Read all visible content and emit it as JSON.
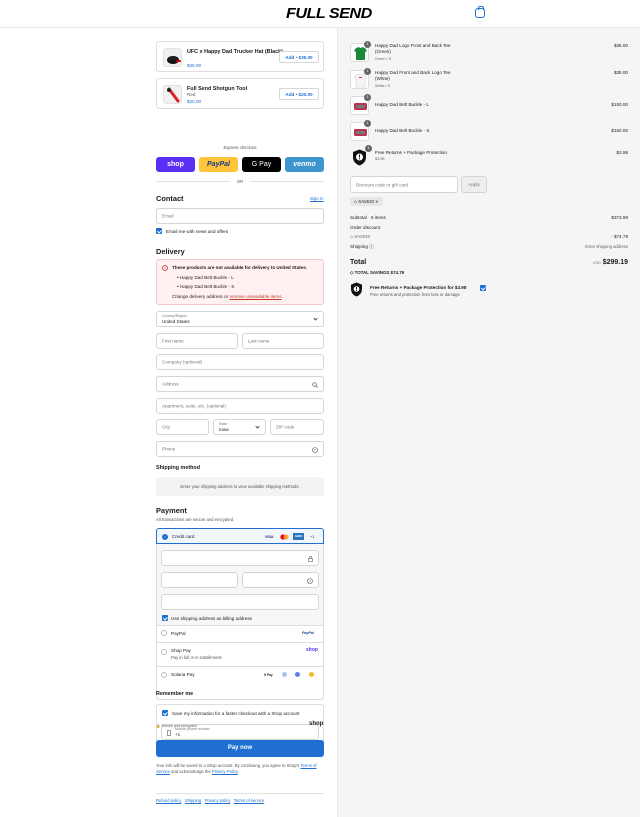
{
  "brand": {
    "logo": "FULL SEND"
  },
  "upsells": [
    {
      "name": "UFC x Happy Dad Trucker Hat (Black)",
      "variant": "",
      "price": "$35.00",
      "add_label": "Add • $35.00"
    },
    {
      "name": "Full Send Shotgun Tool",
      "variant": "Red",
      "price": "$20.00",
      "add_label": "Add • $20.00"
    }
  ],
  "express": {
    "label": "Express checkout",
    "or": "OR",
    "shop": "shop",
    "paypal": "PayPal",
    "gpay": "G Pay",
    "venmo": "venmo"
  },
  "contact": {
    "title": "Contact",
    "sign_in": "Sign in",
    "email_placeholder": "Email",
    "news_label": "Email me with news and offers"
  },
  "delivery": {
    "title": "Delivery",
    "alert_title": "These products are not available for delivery to United States.",
    "alert_items": [
      "Happy Dad Belt Buckle - L",
      "Happy Dad Belt Buckle - S"
    ],
    "alert_footer_prefix": "Change delivery address or",
    "alert_footer_link": "remove unavailable items",
    "alert_footer_suffix": ".",
    "country_label": "Country/Region",
    "country_value": "United States",
    "first_name": "First name",
    "last_name": "Last name",
    "company": "Company (optional)",
    "address": "Address",
    "apartment": "Apartment, suite, etc. (optional)",
    "city": "City",
    "state_label": "State",
    "state_value": "Iowa",
    "zip": "ZIP code",
    "phone": "Phone"
  },
  "shipping": {
    "title": "Shipping method",
    "placeholder": "Enter your shipping address to view available shipping methods."
  },
  "payment": {
    "title": "Payment",
    "subtitle": "All transactions are secure and encrypted.",
    "credit_card": "Credit card",
    "card_logos": [
      "VISA",
      "MC",
      "AMEX",
      "+1"
    ],
    "billing_label": "Use shipping address as billing address",
    "paypal": "PayPal",
    "paypal_logo": "PayPal",
    "shop_pay": "Shop Pay",
    "shop_pay_sub": "Pay in full or in installments",
    "shop_logo": "shop",
    "solana": "Solana Pay",
    "solana_logos": [
      "S Pay",
      "",
      "",
      ""
    ]
  },
  "remember": {
    "title": "Remember me",
    "save_label": "Save my information for a faster checkout with a Shop account",
    "phone_label": "Mobile phone number",
    "phone_value": "+1",
    "secure": "Secure and encrypted",
    "shop_logo": "shop"
  },
  "pay_button": "Pay now",
  "terms": {
    "prefix": "Your info will be saved to a Shop account. By continuing, you agree to Shop's",
    "terms_link": "Terms of Service",
    "middle": "and acknowledge the",
    "privacy_link": "Privacy Policy",
    "suffix": "."
  },
  "footer_links": [
    "Refund policy",
    "Shipping",
    "Privacy policy",
    "Terms of service"
  ],
  "order": {
    "items": [
      {
        "qty": "1",
        "name": "Happy Dad Logo Front and Back Tee (Green)",
        "variant": "Green / S",
        "price": "$35.00"
      },
      {
        "qty": "1",
        "name": "Happy Dad Front and Back Logo Tee (White)",
        "variant": "White / S",
        "price": "$35.00"
      },
      {
        "qty": "1",
        "name": "Happy Dad Belt Buckle - L",
        "variant": "",
        "price": "$150.00"
      },
      {
        "qty": "1",
        "name": "Happy Dad Belt Buckle - S",
        "variant": "",
        "price": "$150.00"
      },
      {
        "qty": "1",
        "name": "Free Returns + Package Protection",
        "variant": "$3.98",
        "price": "$3.98"
      }
    ],
    "discount_placeholder": "Discount code or gift card",
    "apply": "Apply",
    "code_tag": "SAVE20",
    "subtotal_label": "Subtotal · 5 items",
    "subtotal_value": "$373.98",
    "order_discount_label": "Order discount",
    "discount_code": "SAVE20",
    "discount_value": "- $74.79",
    "shipping_label": "Shipping",
    "shipping_value": "Enter shipping address",
    "total_label": "Total",
    "currency": "USD",
    "total_value": "$299.19",
    "savings_label": "TOTAL SAVINGS",
    "savings_value": "$74.79",
    "protection_title": "Free Returns + Package Protection for $3.98",
    "protection_sub": "Free returns and protection from loss or damage"
  },
  "colors": {
    "accent": "#1f6fd1",
    "shop": "#5a31f4",
    "paypal": "#ffc439",
    "venmo": "#3d95ce",
    "alert_bg": "#fff1f1"
  }
}
